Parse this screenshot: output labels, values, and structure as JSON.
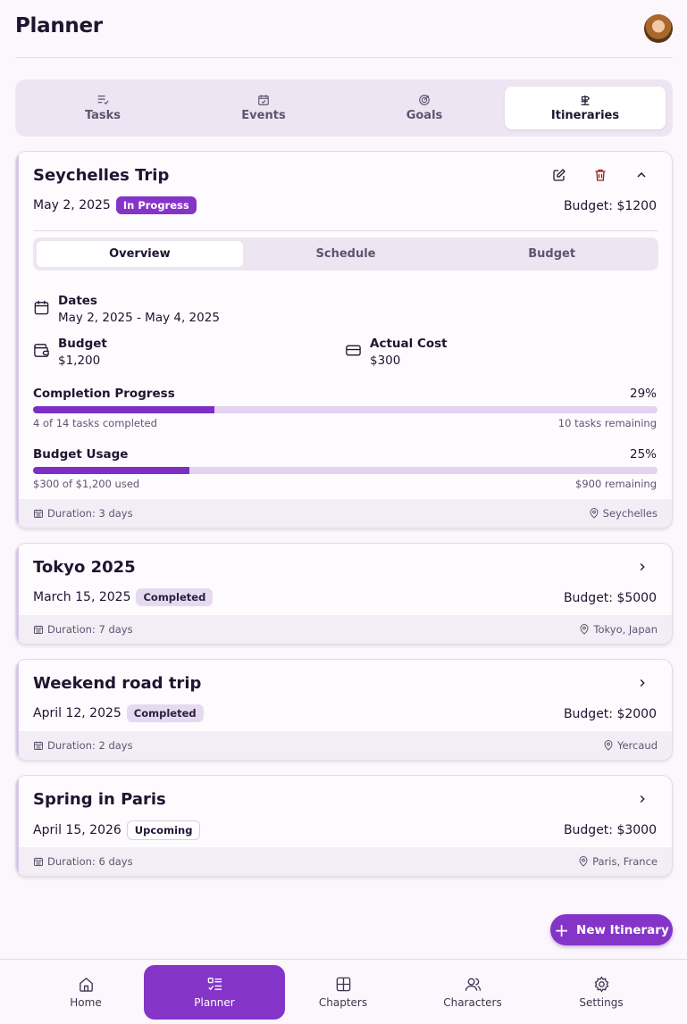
{
  "header": {
    "title": "Planner"
  },
  "tabs": [
    {
      "label": "Tasks",
      "icon": "list-check-icon"
    },
    {
      "label": "Events",
      "icon": "calendar-check-icon"
    },
    {
      "label": "Goals",
      "icon": "target-icon"
    },
    {
      "label": "Itineraries",
      "icon": "map-signs-icon"
    }
  ],
  "active_tab": "Itineraries",
  "cards": [
    {
      "title": "Seychelles Trip",
      "date": "May 2, 2025",
      "status": "In Progress",
      "budget": "Budget: $1200",
      "duration": "Duration: 3 days",
      "location": "Seychelles",
      "expanded": true,
      "subtabs": [
        "Overview",
        "Schedule",
        "Budget"
      ],
      "dates_label": "Dates",
      "dates_value": "May 2, 2025 - May 4, 2025",
      "budget_label": "Budget",
      "budget_value": "$1,200",
      "actual_label": "Actual Cost",
      "actual_value": "$300",
      "completion_label": "Completion Progress",
      "completion_pct": "29%",
      "completion_fraction": 0.29,
      "completion_sub": "4 of 14 tasks completed",
      "completion_remaining": "10 tasks remaining",
      "usage_label": "Budget Usage",
      "usage_pct": "25%",
      "usage_fraction": 0.25,
      "usage_sub": "$300 of $1,200 used",
      "usage_remaining": "$900 remaining"
    },
    {
      "title": "Tokyo 2025",
      "date": "March 15, 2025",
      "status": "Completed",
      "budget": "Budget: $5000",
      "duration": "Duration: 7 days",
      "location": "Tokyo, Japan"
    },
    {
      "title": "Weekend road trip",
      "date": "April 12, 2025",
      "status": "Completed",
      "budget": "Budget: $2000",
      "duration": "Duration: 2 days",
      "location": "Yercaud"
    },
    {
      "title": "Spring in Paris",
      "date": "April 15, 2026",
      "status": "Upcoming",
      "budget": "Budget: $3000",
      "duration": "Duration: 6 days",
      "location": "Paris, France"
    }
  ],
  "fab": {
    "label": "New Itinerary"
  },
  "nav": [
    {
      "label": "Home",
      "icon": "home-icon"
    },
    {
      "label": "Planner",
      "icon": "planner-icon"
    },
    {
      "label": "Chapters",
      "icon": "grid-icon"
    },
    {
      "label": "Characters",
      "icon": "users-icon"
    },
    {
      "label": "Settings",
      "icon": "gear-icon"
    }
  ],
  "active_nav": "Planner",
  "colors": {
    "accent": "#8534c8",
    "background": "#fcf7fc",
    "delete": "#9b1c1c"
  }
}
